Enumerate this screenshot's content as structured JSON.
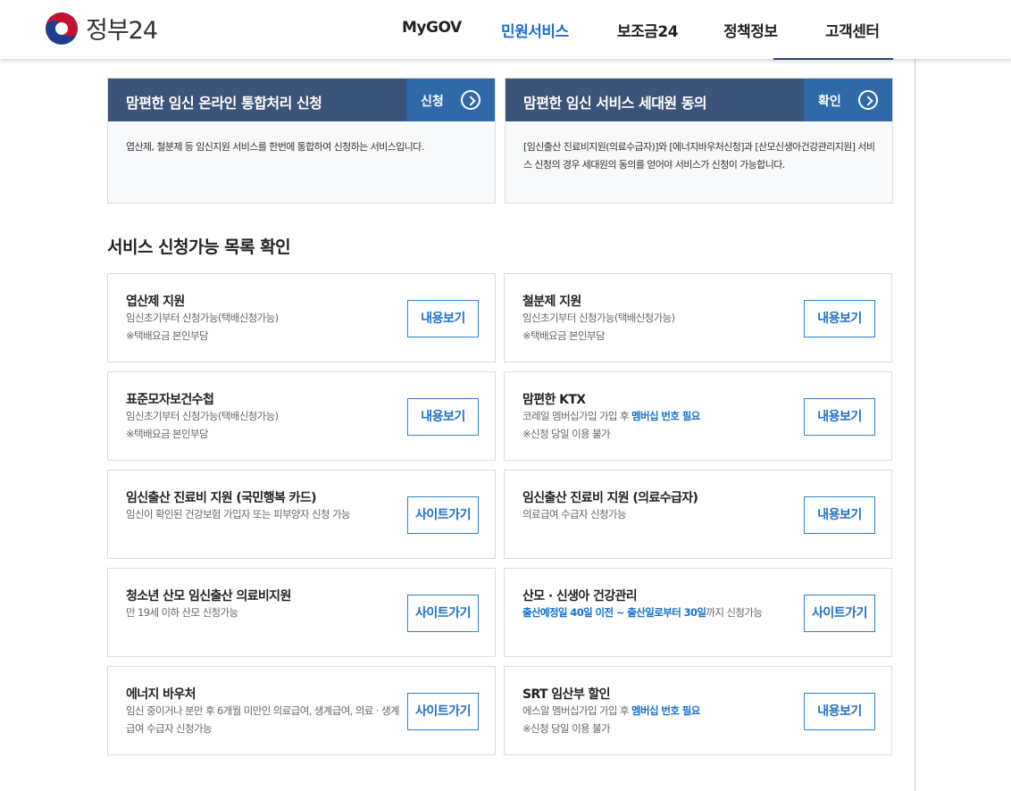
{
  "header": {
    "logo_text": "정부24",
    "nav": [
      {
        "label": "MyGOV",
        "active": false
      },
      {
        "label": "민원서비스",
        "active": true
      },
      {
        "label": "보조금24",
        "active": false
      },
      {
        "label": "정책정보",
        "active": false
      },
      {
        "label": "고객센터",
        "active": false
      }
    ]
  },
  "panels": [
    {
      "title": "맘편한 임신 온라인 통합처리 신청",
      "button": "신청",
      "desc": "엽산제, 철분제 등 임신지원 서비스를 한번에 통합하여 신청하는 서비스입니다."
    },
    {
      "title": "맘편한 임신 서비스 세대원 동의",
      "button": "확인",
      "desc": "[임신출산 진료비지원(의료수급자)]와 [에너지바우처신청]과 [산모신생아건강관리지원] 서비스 신청의 경우 세대원의 동의를 얻어야 서비스가 신청이 가능합니다."
    }
  ],
  "section_title": "서비스 신청가능 목록 확인",
  "cards": [
    {
      "title": "엽산제 지원",
      "desc": "임신초기부터 신청가능(택배신청가능)",
      "note": "※택배요금 본인부담",
      "button": "내용보기"
    },
    {
      "title": "철분제 지원",
      "desc": "임신초기부터 신청가능(택배신청가능)",
      "note": "※택배요금 본인부담",
      "button": "내용보기"
    },
    {
      "title": "표준모자보건수첩",
      "desc": "임신초기부터 신청가능(택배신청가능)",
      "note": "※택배요금 본인부담",
      "button": "내용보기"
    },
    {
      "title": "맘편한 KTX",
      "desc_pre": "코레일 멤버십가입 가입 후 ",
      "desc_hl": "멤버십 번호 필요",
      "note": "※신청 당일 이용 불가",
      "button": "내용보기"
    },
    {
      "title": "임신출산 진료비 지원 (국민행복 카드)",
      "desc": "임신이 확인된 건강보험 가입자 또는 피부양자 신청 가능",
      "button": "사이트가기"
    },
    {
      "title": "임신출산 진료비 지원 (의료수급자)",
      "desc": "의료급여 수급자 신청가능",
      "button": "내용보기"
    },
    {
      "title": "청소년 산모 임신출산 의료비지원",
      "desc": "만 19세 이하 산모 신청가능",
      "button": "사이트가기"
    },
    {
      "title": "산모 · 신생아 건강관리",
      "desc_hl": "출산예정일 40일 이전 ~ 출산일로부터 30일",
      "desc_post": "까지 신청가능",
      "button": "사이트가기"
    },
    {
      "title": "에너지 바우처",
      "desc": "임신 중이거나 분만 후 6개월 미만인 의료급여, 생계급여, 의료 · 생계급여 수급자 신청가능",
      "button": "사이트가기"
    },
    {
      "title": "SRT 임산부 할인",
      "desc_pre": "에스알 멤버십가입 가입 후 ",
      "desc_hl": "멤버십 번호 필요",
      "note": "※신청 당일 이용 불가",
      "button": "내용보기"
    }
  ]
}
